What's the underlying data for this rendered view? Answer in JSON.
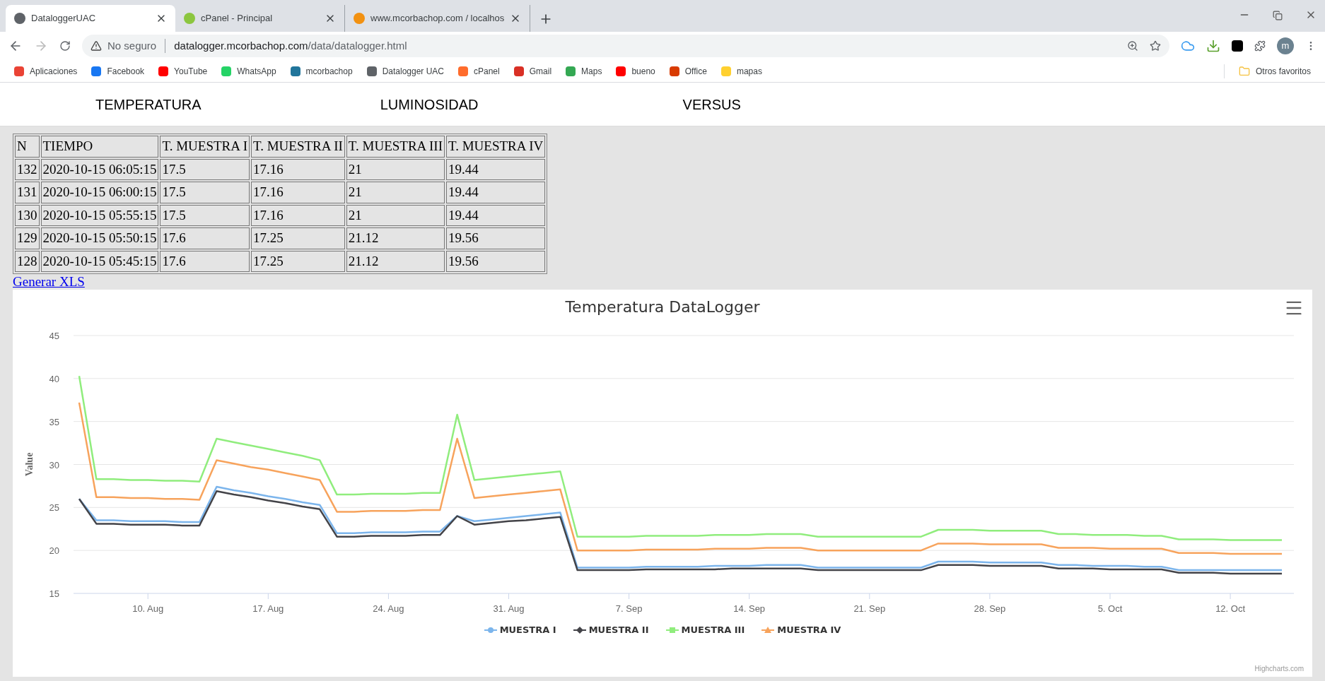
{
  "browser": {
    "tabs": [
      {
        "title": "DataloggerUAC",
        "selected": true,
        "color": "#5f6368"
      },
      {
        "title": "cPanel - Principal",
        "selected": false,
        "color": "#8cc63f"
      },
      {
        "title": "www.mcorbachop.com / localhos",
        "selected": false,
        "color": "#f29111"
      }
    ],
    "security": "No seguro",
    "url_host": "datalogger.mcorbachop.com",
    "url_path": "/data/datalogger.html",
    "profile": "m",
    "bookmarks": [
      {
        "label": "Aplicaciones",
        "color": "#ea4335"
      },
      {
        "label": "Facebook",
        "color": "#1877f2"
      },
      {
        "label": "YouTube",
        "color": "#ff0000"
      },
      {
        "label": "WhatsApp",
        "color": "#25d366"
      },
      {
        "label": "mcorbachop",
        "color": "#21759b"
      },
      {
        "label": "Datalogger UAC",
        "color": "#5f6368"
      },
      {
        "label": "cPanel",
        "color": "#ff6c2c"
      },
      {
        "label": "Gmail",
        "color": "#d93025"
      },
      {
        "label": "Maps",
        "color": "#34a853"
      },
      {
        "label": "bueno",
        "color": "#ff0000"
      },
      {
        "label": "Office",
        "color": "#d83b01"
      },
      {
        "label": "mapas",
        "color": "#ffd02f"
      }
    ],
    "other_bookmarks": "Otros favoritos"
  },
  "nav": [
    "TEMPERATURA",
    "LUMINOSIDAD",
    "VERSUS"
  ],
  "table": {
    "columns": [
      "N",
      "TIEMPO",
      "T. MUESTRA I",
      "T. MUESTRA II",
      "T. MUESTRA III",
      "T. MUESTRA IV"
    ],
    "rows": [
      [
        "132",
        "2020-10-15 06:05:15",
        "17.5",
        "17.16",
        "21",
        "19.44"
      ],
      [
        "131",
        "2020-10-15 06:00:15",
        "17.5",
        "17.16",
        "21",
        "19.44"
      ],
      [
        "130",
        "2020-10-15 05:55:15",
        "17.5",
        "17.16",
        "21",
        "19.44"
      ],
      [
        "129",
        "2020-10-15 05:50:15",
        "17.6",
        "17.25",
        "21.12",
        "19.56"
      ],
      [
        "128",
        "2020-10-15 05:45:15",
        "17.6",
        "17.25",
        "21.12",
        "19.56"
      ]
    ]
  },
  "link": "Generar XLS",
  "chart": {
    "chart_data": {
      "type": "line",
      "title": "Temperatura DataLogger",
      "ylabel": "Value",
      "categories": [
        null,
        null,
        null,
        null,
        "10. Aug",
        null,
        null,
        null,
        null,
        null,
        null,
        "17. Aug",
        null,
        null,
        null,
        null,
        null,
        null,
        "24. Aug",
        null,
        null,
        null,
        null,
        null,
        null,
        "31. Aug",
        null,
        null,
        null,
        null,
        null,
        null,
        "7. Sep",
        null,
        null,
        null,
        null,
        null,
        null,
        "14. Sep",
        null,
        null,
        null,
        null,
        null,
        null,
        "21. Sep",
        null,
        null,
        null,
        null,
        null,
        null,
        "28. Sep",
        null,
        null,
        null,
        null,
        null,
        null,
        "5. Oct",
        null,
        null,
        null,
        null,
        null,
        null,
        "12. Oct",
        null,
        null,
        null
      ],
      "series": [
        {
          "name": "MUESTRA I",
          "color": "#7cb5ec",
          "values": [
            26.0,
            23.5,
            23.5,
            23.4,
            23.4,
            23.4,
            23.3,
            23.3,
            27.4,
            27.0,
            26.7,
            26.3,
            26.0,
            25.6,
            25.3,
            22.0,
            22.0,
            22.1,
            22.1,
            22.1,
            22.2,
            22.2,
            24.0,
            23.4,
            23.6,
            23.8,
            24.0,
            24.2,
            24.4,
            18.0,
            18.0,
            18.0,
            18.0,
            18.1,
            18.1,
            18.1,
            18.1,
            18.2,
            18.2,
            18.2,
            18.3,
            18.3,
            18.3,
            18.0,
            18.0,
            18.0,
            18.0,
            18.0,
            18.0,
            18.0,
            18.7,
            18.7,
            18.7,
            18.6,
            18.6,
            18.6,
            18.6,
            18.3,
            18.3,
            18.2,
            18.2,
            18.2,
            18.1,
            18.1,
            17.7,
            17.7,
            17.7,
            17.7,
            17.7,
            17.7,
            17.7
          ]
        },
        {
          "name": "MUESTRA II",
          "color": "#434348",
          "values": [
            26.0,
            23.1,
            23.1,
            23.0,
            23.0,
            23.0,
            22.9,
            22.9,
            26.9,
            26.5,
            26.2,
            25.8,
            25.5,
            25.1,
            24.8,
            21.6,
            21.6,
            21.7,
            21.7,
            21.7,
            21.8,
            21.8,
            24.0,
            23.0,
            23.2,
            23.4,
            23.5,
            23.7,
            23.9,
            17.7,
            17.7,
            17.7,
            17.7,
            17.8,
            17.8,
            17.8,
            17.8,
            17.8,
            17.9,
            17.9,
            17.9,
            17.9,
            17.9,
            17.7,
            17.7,
            17.7,
            17.7,
            17.7,
            17.7,
            17.7,
            18.3,
            18.3,
            18.3,
            18.2,
            18.2,
            18.2,
            18.2,
            17.9,
            17.9,
            17.9,
            17.8,
            17.8,
            17.8,
            17.8,
            17.4,
            17.4,
            17.4,
            17.3,
            17.3,
            17.3,
            17.3
          ]
        },
        {
          "name": "MUESTRA III",
          "color": "#90ed7d",
          "values": [
            40.3,
            28.3,
            28.3,
            28.2,
            28.2,
            28.1,
            28.1,
            28.0,
            33.0,
            32.6,
            32.2,
            31.8,
            31.4,
            31.0,
            30.5,
            26.5,
            26.5,
            26.6,
            26.6,
            26.6,
            26.7,
            26.7,
            35.8,
            28.2,
            28.4,
            28.6,
            28.8,
            29.0,
            29.2,
            21.6,
            21.6,
            21.6,
            21.6,
            21.7,
            21.7,
            21.7,
            21.7,
            21.8,
            21.8,
            21.8,
            21.9,
            21.9,
            21.9,
            21.6,
            21.6,
            21.6,
            21.6,
            21.6,
            21.6,
            21.6,
            22.4,
            22.4,
            22.4,
            22.3,
            22.3,
            22.3,
            22.3,
            21.9,
            21.9,
            21.8,
            21.8,
            21.8,
            21.7,
            21.7,
            21.3,
            21.3,
            21.3,
            21.2,
            21.2,
            21.2,
            21.2
          ]
        },
        {
          "name": "MUESTRA IV",
          "color": "#f7a35c",
          "values": [
            37.2,
            26.2,
            26.2,
            26.1,
            26.1,
            26.0,
            26.0,
            25.9,
            30.5,
            30.1,
            29.7,
            29.4,
            29.0,
            28.6,
            28.2,
            24.5,
            24.5,
            24.6,
            24.6,
            24.6,
            24.7,
            24.7,
            33.0,
            26.1,
            26.3,
            26.5,
            26.7,
            26.9,
            27.1,
            20.0,
            20.0,
            20.0,
            20.0,
            20.1,
            20.1,
            20.1,
            20.1,
            20.2,
            20.2,
            20.2,
            20.3,
            20.3,
            20.3,
            20.0,
            20.0,
            20.0,
            20.0,
            20.0,
            20.0,
            20.0,
            20.8,
            20.8,
            20.8,
            20.7,
            20.7,
            20.7,
            20.7,
            20.3,
            20.3,
            20.3,
            20.2,
            20.2,
            20.2,
            20.2,
            19.7,
            19.7,
            19.7,
            19.6,
            19.6,
            19.6,
            19.6
          ]
        }
      ],
      "ylim": [
        15,
        45
      ],
      "grid": true,
      "yticks": [
        15,
        20,
        25,
        30,
        35,
        40,
        45
      ]
    },
    "credits": "Highcharts.com"
  }
}
